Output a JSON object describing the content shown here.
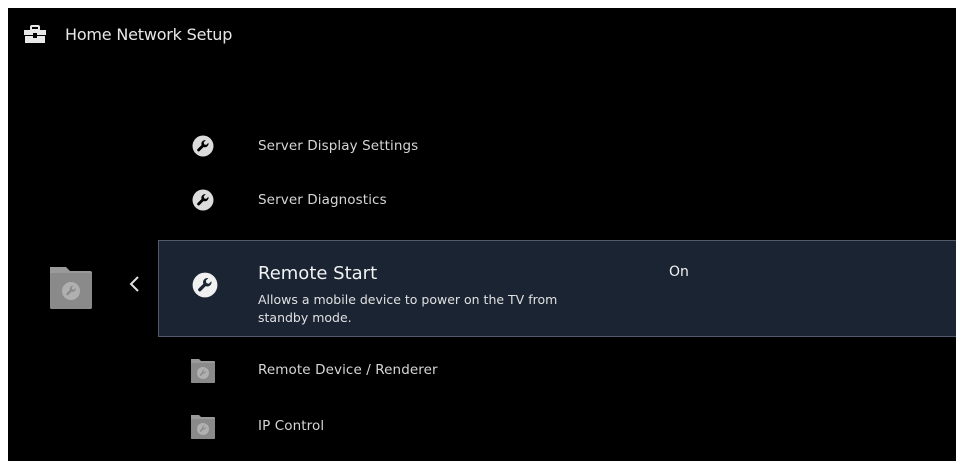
{
  "header": {
    "title": "Home Network Setup",
    "icon": "toolbox-icon"
  },
  "menu": {
    "items": [
      {
        "label": "Server Display Settings",
        "icon": "wrench-icon"
      },
      {
        "label": "Server Diagnostics",
        "icon": "wrench-icon"
      }
    ],
    "selected": {
      "title": "Remote Start",
      "description": "Allows a mobile device to power on the TV from standby mode.",
      "value": "On",
      "icon": "wrench-icon"
    },
    "subfolders": [
      {
        "label": "Remote Device / Renderer",
        "icon": "folder-wrench-icon"
      },
      {
        "label": "IP Control",
        "icon": "folder-wrench-icon"
      }
    ]
  },
  "colors": {
    "background": "#000000",
    "selected_background": "#1b2433",
    "selected_border": "#4f5a6c",
    "text": "#d6d6d6"
  }
}
